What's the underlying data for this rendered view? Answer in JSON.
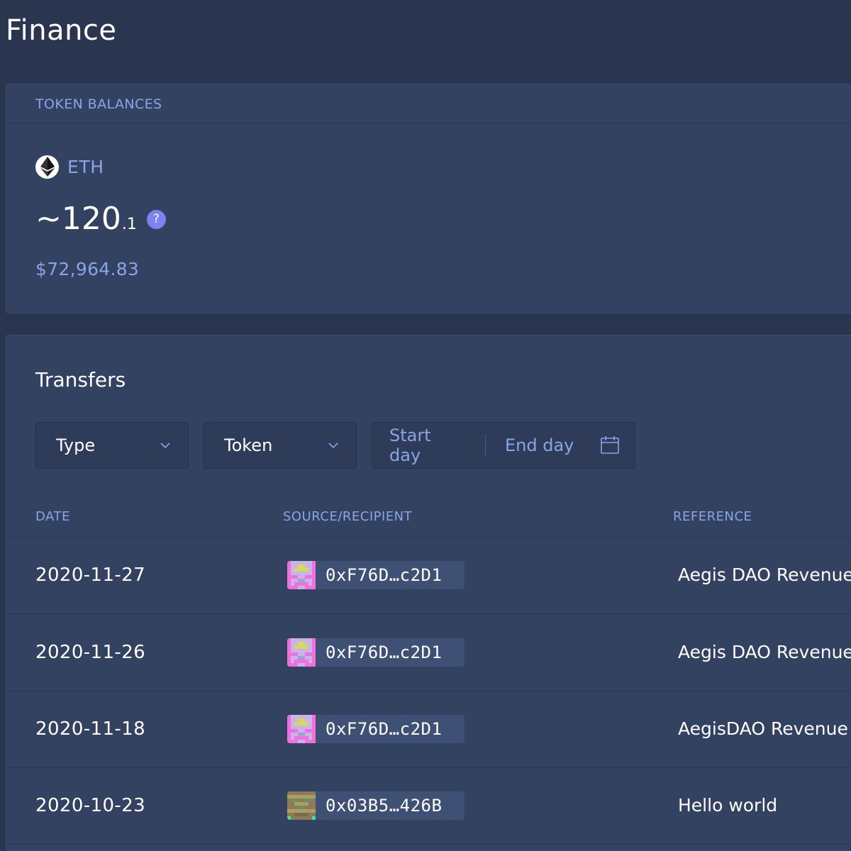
{
  "page": {
    "title": "Finance"
  },
  "balances": {
    "label": "TOKEN BALANCES",
    "token": {
      "symbol": "ETH",
      "icon": "ethereum-icon",
      "amount_main": "~120",
      "amount_decimal": ".1",
      "help_glyph": "?",
      "fiat_value": "$72,964.83"
    }
  },
  "transfers": {
    "title": "Transfers",
    "filters": {
      "type_label": "Type",
      "token_label": "Token",
      "start_day": "Start day",
      "end_day": "End day"
    },
    "columns": {
      "date": "DATE",
      "source": "SOURCE/RECIPIENT",
      "reference": "REFERENCE"
    },
    "rows": [
      {
        "date": "2020-11-27",
        "address": "0xF76D…c2D1",
        "reference": "Aegis DAO Revenue",
        "identicon": "pink"
      },
      {
        "date": "2020-11-26",
        "address": "0xF76D…c2D1",
        "reference": "Aegis DAO Revenue",
        "identicon": "pink"
      },
      {
        "date": "2020-11-18",
        "address": "0xF76D…c2D1",
        "reference": "AegisDAO Revenue",
        "identicon": "pink"
      },
      {
        "date": "2020-10-23",
        "address": "0x03B5…426B",
        "reference": "Hello world",
        "identicon": "olive"
      }
    ]
  },
  "colors": {
    "background": "#2a3550",
    "card": "#344261",
    "accent_text": "#8aa4e6",
    "help_badge": "#7b83f0",
    "address_badge": "#3f5075"
  }
}
